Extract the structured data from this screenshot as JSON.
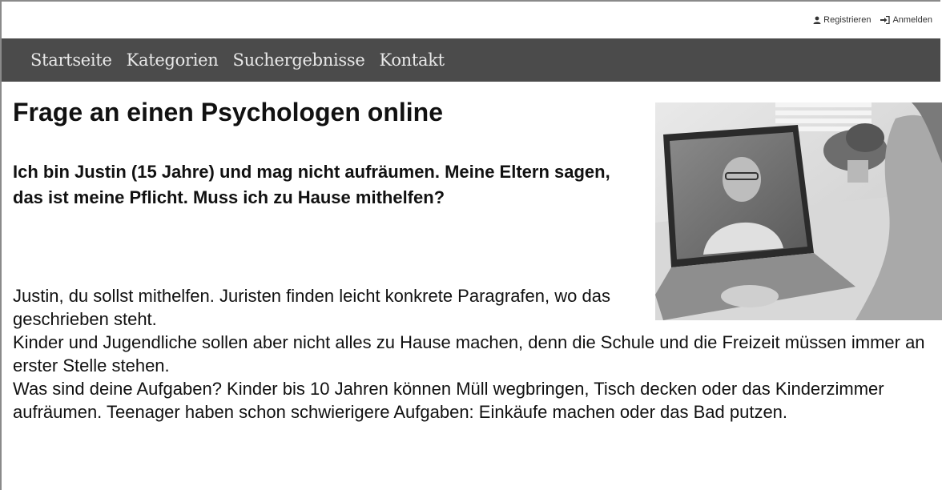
{
  "topbar": {
    "register_label": "Registrieren",
    "login_label": "Anmelden",
    "register_icon": "user-icon",
    "login_icon": "sign-in-icon"
  },
  "nav": {
    "items": [
      "Startseite",
      "Kategorien",
      "Suchergebnisse",
      "Kontakt"
    ]
  },
  "article": {
    "title": "Frage an einen Psychologen online",
    "question": "Ich bin Justin (15 Jahre) und mag nicht aufräumen. Meine Eltern sagen, das ist meine Pflicht. Muss ich zu Hause mithelfen?",
    "paragraphs": [
      "Justin, du sollst mithelfen. Juristen finden leicht konkrete Paragrafen, wo das geschrieben steht.",
      "Kinder und Jugendliche sollen aber nicht alles zu Hause machen, denn die Schule und die Freizeit müssen immer an erster Stelle stehen.",
      "Was sind deine Aufgaben? Kinder bis 10 Jahren können Müll wegbringen, Tisch decken oder das Kinderzimmer aufräumen. Teenager haben schon schwierigere Aufgaben: Einkäufe machen oder das Bad putzen."
    ]
  },
  "colors": {
    "nav_background": "#4b4b4b",
    "nav_text": "#e8e8e8"
  }
}
